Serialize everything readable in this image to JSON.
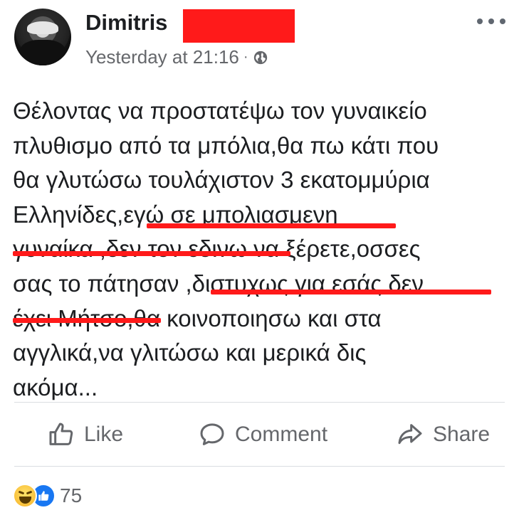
{
  "author": {
    "name": "Dimitris",
    "timestamp": "Yesterday at 21:16",
    "separator": "·",
    "privacy_icon": "globe-icon"
  },
  "menu": {
    "icon": "more-horizontal-icon"
  },
  "post": {
    "lines": [
      "Θέλοντας να προστατέψω τον γυναικείο",
      "πλυθισμο από τα μπόλια,θα πω κάτι που",
      "θα γλυτώσω τουλάχιστον 3 εκατομμύρια",
      "Ελληνίδες,εγώ σε μπολιασμενη",
      "γυναίκα ,δεν τον εδινω να ξέρετε,οσσες",
      "σας το πάτησαν ,διστυχως για εσάς δεν",
      "έχει Μήτσο,θα κοινοποιησω και στα",
      "αγγλικά,να γλιτώσω και μερικά δις",
      "ακόμα..."
    ]
  },
  "actions": {
    "like": "Like",
    "comment": "Comment",
    "share": "Share"
  },
  "reactions": {
    "icons": [
      "haha-icon",
      "like-reaction-icon"
    ],
    "count": "75"
  },
  "colors": {
    "redaction": "#ff1a1a",
    "annotation_underline": "#ff1a1a",
    "meta_text": "#65676b",
    "like_blue": "#1877f2"
  }
}
